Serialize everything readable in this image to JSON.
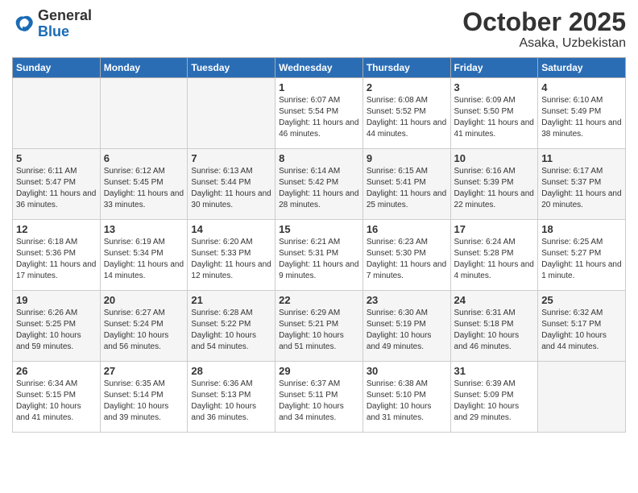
{
  "logo": {
    "general": "General",
    "blue": "Blue"
  },
  "header": {
    "month": "October 2025",
    "location": "Asaka, Uzbekistan"
  },
  "weekdays": [
    "Sunday",
    "Monday",
    "Tuesday",
    "Wednesday",
    "Thursday",
    "Friday",
    "Saturday"
  ],
  "weeks": [
    [
      {
        "day": "",
        "info": "",
        "empty": true
      },
      {
        "day": "",
        "info": "",
        "empty": true
      },
      {
        "day": "",
        "info": "",
        "empty": true
      },
      {
        "day": "1",
        "info": "Sunrise: 6:07 AM\nSunset: 5:54 PM\nDaylight: 11 hours and 46 minutes."
      },
      {
        "day": "2",
        "info": "Sunrise: 6:08 AM\nSunset: 5:52 PM\nDaylight: 11 hours and 44 minutes."
      },
      {
        "day": "3",
        "info": "Sunrise: 6:09 AM\nSunset: 5:50 PM\nDaylight: 11 hours and 41 minutes."
      },
      {
        "day": "4",
        "info": "Sunrise: 6:10 AM\nSunset: 5:49 PM\nDaylight: 11 hours and 38 minutes."
      }
    ],
    [
      {
        "day": "5",
        "info": "Sunrise: 6:11 AM\nSunset: 5:47 PM\nDaylight: 11 hours and 36 minutes."
      },
      {
        "day": "6",
        "info": "Sunrise: 6:12 AM\nSunset: 5:45 PM\nDaylight: 11 hours and 33 minutes."
      },
      {
        "day": "7",
        "info": "Sunrise: 6:13 AM\nSunset: 5:44 PM\nDaylight: 11 hours and 30 minutes."
      },
      {
        "day": "8",
        "info": "Sunrise: 6:14 AM\nSunset: 5:42 PM\nDaylight: 11 hours and 28 minutes."
      },
      {
        "day": "9",
        "info": "Sunrise: 6:15 AM\nSunset: 5:41 PM\nDaylight: 11 hours and 25 minutes."
      },
      {
        "day": "10",
        "info": "Sunrise: 6:16 AM\nSunset: 5:39 PM\nDaylight: 11 hours and 22 minutes."
      },
      {
        "day": "11",
        "info": "Sunrise: 6:17 AM\nSunset: 5:37 PM\nDaylight: 11 hours and 20 minutes."
      }
    ],
    [
      {
        "day": "12",
        "info": "Sunrise: 6:18 AM\nSunset: 5:36 PM\nDaylight: 11 hours and 17 minutes."
      },
      {
        "day": "13",
        "info": "Sunrise: 6:19 AM\nSunset: 5:34 PM\nDaylight: 11 hours and 14 minutes."
      },
      {
        "day": "14",
        "info": "Sunrise: 6:20 AM\nSunset: 5:33 PM\nDaylight: 11 hours and 12 minutes."
      },
      {
        "day": "15",
        "info": "Sunrise: 6:21 AM\nSunset: 5:31 PM\nDaylight: 11 hours and 9 minutes."
      },
      {
        "day": "16",
        "info": "Sunrise: 6:23 AM\nSunset: 5:30 PM\nDaylight: 11 hours and 7 minutes."
      },
      {
        "day": "17",
        "info": "Sunrise: 6:24 AM\nSunset: 5:28 PM\nDaylight: 11 hours and 4 minutes."
      },
      {
        "day": "18",
        "info": "Sunrise: 6:25 AM\nSunset: 5:27 PM\nDaylight: 11 hours and 1 minute."
      }
    ],
    [
      {
        "day": "19",
        "info": "Sunrise: 6:26 AM\nSunset: 5:25 PM\nDaylight: 10 hours and 59 minutes."
      },
      {
        "day": "20",
        "info": "Sunrise: 6:27 AM\nSunset: 5:24 PM\nDaylight: 10 hours and 56 minutes."
      },
      {
        "day": "21",
        "info": "Sunrise: 6:28 AM\nSunset: 5:22 PM\nDaylight: 10 hours and 54 minutes."
      },
      {
        "day": "22",
        "info": "Sunrise: 6:29 AM\nSunset: 5:21 PM\nDaylight: 10 hours and 51 minutes."
      },
      {
        "day": "23",
        "info": "Sunrise: 6:30 AM\nSunset: 5:19 PM\nDaylight: 10 hours and 49 minutes."
      },
      {
        "day": "24",
        "info": "Sunrise: 6:31 AM\nSunset: 5:18 PM\nDaylight: 10 hours and 46 minutes."
      },
      {
        "day": "25",
        "info": "Sunrise: 6:32 AM\nSunset: 5:17 PM\nDaylight: 10 hours and 44 minutes."
      }
    ],
    [
      {
        "day": "26",
        "info": "Sunrise: 6:34 AM\nSunset: 5:15 PM\nDaylight: 10 hours and 41 minutes."
      },
      {
        "day": "27",
        "info": "Sunrise: 6:35 AM\nSunset: 5:14 PM\nDaylight: 10 hours and 39 minutes."
      },
      {
        "day": "28",
        "info": "Sunrise: 6:36 AM\nSunset: 5:13 PM\nDaylight: 10 hours and 36 minutes."
      },
      {
        "day": "29",
        "info": "Sunrise: 6:37 AM\nSunset: 5:11 PM\nDaylight: 10 hours and 34 minutes."
      },
      {
        "day": "30",
        "info": "Sunrise: 6:38 AM\nSunset: 5:10 PM\nDaylight: 10 hours and 31 minutes."
      },
      {
        "day": "31",
        "info": "Sunrise: 6:39 AM\nSunset: 5:09 PM\nDaylight: 10 hours and 29 minutes."
      },
      {
        "day": "",
        "info": "",
        "empty": true
      }
    ]
  ]
}
